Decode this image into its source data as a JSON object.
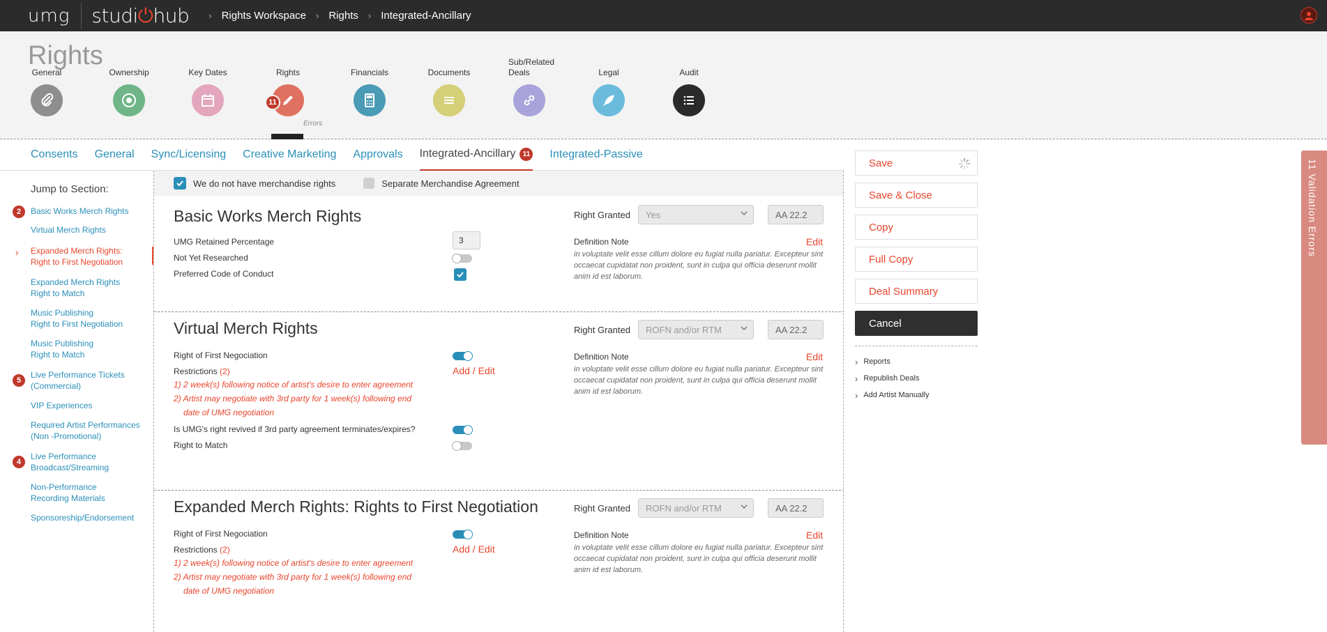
{
  "app": {
    "logo_left": "umg",
    "logo_right_a": "studi",
    "logo_right_b": "hub",
    "breadcrumbs": [
      "Rights Workspace",
      "Rights",
      "Integrated-Ancillary"
    ]
  },
  "page": {
    "title": "Rights"
  },
  "steps": [
    {
      "label": "General",
      "color": "#8e8e8e",
      "icon": "paperclip-icon"
    },
    {
      "label": "Ownership",
      "color": "#6fb587",
      "icon": "target-icon"
    },
    {
      "label": "Key Dates",
      "color": "#e3a6bd",
      "icon": "calendar-icon"
    },
    {
      "label": "Rights",
      "color": "#e0705f",
      "icon": "pen-icon",
      "badge": "11",
      "errors": "Errors"
    },
    {
      "label": "Financials",
      "color": "#4a9bb5",
      "icon": "calculator-icon"
    },
    {
      "label": "Documents",
      "color": "#d4cf78",
      "icon": "lines-icon"
    },
    {
      "label": "Sub/Related Deals",
      "color": "#a8a3da",
      "icon": "link-icon"
    },
    {
      "label": "Legal",
      "color": "#6bbbdc",
      "icon": "feather-icon"
    },
    {
      "label": "Audit",
      "color": "#2a2a2a",
      "icon": "list-icon"
    }
  ],
  "tabs": [
    {
      "label": "Consents"
    },
    {
      "label": "General"
    },
    {
      "label": "Sync/Licensing"
    },
    {
      "label": "Creative Marketing"
    },
    {
      "label": "Approvals"
    },
    {
      "label": "Integrated-Ancillary",
      "badge": "11"
    },
    {
      "label": "Integrated-Passive"
    }
  ],
  "jump": {
    "title": "Jump to Section:",
    "items": [
      {
        "label": "Basic Works Merch Rights",
        "badge": "2"
      },
      {
        "label": "Virtual Merch Rights"
      },
      {
        "label": "Expanded Merch Rights:",
        "label2": "Right to First Negotiation"
      },
      {
        "label": "Expanded Merch Rights",
        "label2": "Right to Match"
      },
      {
        "label": "Music Publishing",
        "label2": "Right to First Negotiation"
      },
      {
        "label": "Music Publishing",
        "label2": "Right to Match"
      },
      {
        "label": "Live Performance Tickets",
        "label2": "(Commercial)",
        "badge": "5"
      },
      {
        "label": "VIP Experiences"
      },
      {
        "label": "Required Artist Performances",
        "label2": "(Non -Promotional)"
      },
      {
        "label": "Live Performance",
        "label2": "Broadcast/Streaming",
        "badge": "4"
      },
      {
        "label": "Non-Performance",
        "label2": "Recording Materials"
      },
      {
        "label": "Sponsoreship/Endorsement"
      }
    ]
  },
  "merch": {
    "no_rights_label": "We do not have merchandise rights",
    "separate_label": "Separate Merchandise Agreement"
  },
  "sections": {
    "basic": {
      "title": "Basic Works Merch Rights",
      "right_granted_label": "Right Granted",
      "right_granted_value": "Yes",
      "code": "AA 22.2",
      "retained_label": "UMG Retained Percentage",
      "retained_value": "3",
      "not_researched_label": "Not Yet Researched",
      "conduct_label": "Preferred Code of Conduct",
      "def_label": "Definition Note",
      "edit_label": "Edit",
      "def_text": "in voluptate velit esse cillum dolore eu fugiat nulla pariatur. Excepteur sint occaecat cupidatat non proident, sunt in culpa qui officia deserunt mollit anim id est laborum."
    },
    "virtual": {
      "title": "Virtual Merch Rights",
      "right_granted_label": "Right Granted",
      "right_granted_value": "ROFN and/or RTM",
      "code": "AA 22.2",
      "rofn_label": "Right of First Negociation",
      "restrictions_label": "Restrictions",
      "restrictions_count": "(2)",
      "add_edit": "Add / Edit",
      "r1": "1) 2 week(s) following notice of artist's desire to enter agreement",
      "r2a": "2) Artist may negotiate with 3rd party for 1 week(s) following end",
      "r2b": "date of UMG negotiation",
      "revived_label": "Is UMG's right revived if 3rd party agreement terminates/expires?",
      "match_label": "Right to Match",
      "def_label": "Definition Note",
      "edit_label": "Edit",
      "def_text": "in voluptate velit esse cillum dolore eu fugiat nulla pariatur. Excepteur sint occaecat cupidatat non proident, sunt in culpa qui officia deserunt mollit anim id est laborum."
    },
    "expanded": {
      "title": "Expanded Merch Rights: Rights to First Negotiation",
      "right_granted_label": "Right Granted",
      "right_granted_value": "ROFN and/or RTM",
      "code": "AA 22.2",
      "rofn_label": "Right of First Negociation",
      "restrictions_label": "Restrictions",
      "restrictions_count": "(2)",
      "add_edit": "Add / Edit",
      "r1": "1) 2 week(s) following notice of artist's desire to enter agreement",
      "r2a": "2) Artist may negotiate with 3rd party for 1 week(s) following end",
      "r2b": "date of UMG negotiation",
      "def_label": "Definition Note",
      "edit_label": "Edit",
      "def_text": "in voluptate velit esse cillum dolore eu fugiat nulla pariatur. Excepteur sint occaecat cupidatat non proident, sunt in culpa qui officia deserunt mollit anim id est laborum."
    }
  },
  "actions": {
    "save": "Save",
    "save_close": "Save & Close",
    "copy": "Copy",
    "full_copy": "Full Copy",
    "deal_summary": "Deal Summary",
    "cancel": "Cancel",
    "links": [
      "Reports",
      "Republish Deals",
      "Add Artist Manually"
    ]
  },
  "validation": {
    "label": "11 Validation Errors"
  },
  "colors": {
    "accent": "#e8452c",
    "link": "#2a8fb8",
    "error": "#c0392b"
  }
}
